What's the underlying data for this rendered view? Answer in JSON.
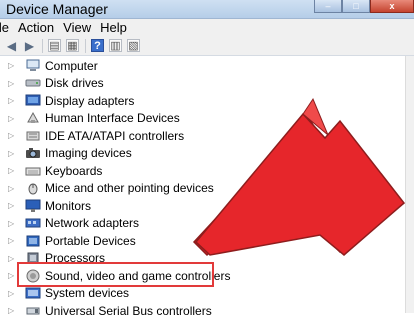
{
  "window": {
    "title": "Device Manager",
    "controls": [
      "–",
      "□",
      "x"
    ]
  },
  "menu": [
    {
      "label": "ile"
    },
    {
      "label": "Action"
    },
    {
      "label": "View"
    },
    {
      "label": "Help"
    }
  ],
  "toolbar": [
    {
      "icon": "back-arrow-icon",
      "glyph": "◀"
    },
    {
      "icon": "forward-arrow-icon",
      "glyph": "▶"
    },
    {
      "icon": "up-folder-icon",
      "glyph": "▤"
    },
    {
      "icon": "properties-icon",
      "glyph": "▦"
    },
    {
      "icon": "help-icon",
      "glyph": "?"
    },
    {
      "icon": "scan-icon",
      "glyph": "▥"
    },
    {
      "icon": "update-driver-icon",
      "glyph": "▧"
    }
  ],
  "tree": {
    "items": [
      {
        "label": "Computer",
        "icon": "computer-icon"
      },
      {
        "label": "Disk drives",
        "icon": "disk-drive-icon"
      },
      {
        "label": "Display adapters",
        "icon": "display-adapter-icon"
      },
      {
        "label": "Human Interface Devices",
        "icon": "hid-icon"
      },
      {
        "label": "IDE ATA/ATAPI controllers",
        "icon": "ide-controller-icon"
      },
      {
        "label": "Imaging devices",
        "icon": "camera-icon"
      },
      {
        "label": "Keyboards",
        "icon": "keyboard-icon"
      },
      {
        "label": "Mice and other pointing devices",
        "icon": "mouse-icon"
      },
      {
        "label": "Monitors",
        "icon": "monitor-icon"
      },
      {
        "label": "Network adapters",
        "icon": "network-adapter-icon"
      },
      {
        "label": "Portable Devices",
        "icon": "portable-device-icon"
      },
      {
        "label": "Processors",
        "icon": "processor-icon"
      },
      {
        "label": "Sound, video and game controllers",
        "icon": "speaker-icon",
        "highlighted": true
      },
      {
        "label": "System devices",
        "icon": "system-devices-icon"
      },
      {
        "label": "Universal Serial Bus controllers",
        "icon": "usb-icon"
      }
    ]
  },
  "colors": {
    "highlight": "#e23a3a",
    "arrow": "#e6262b",
    "titlebar": "#c4d9f0"
  }
}
